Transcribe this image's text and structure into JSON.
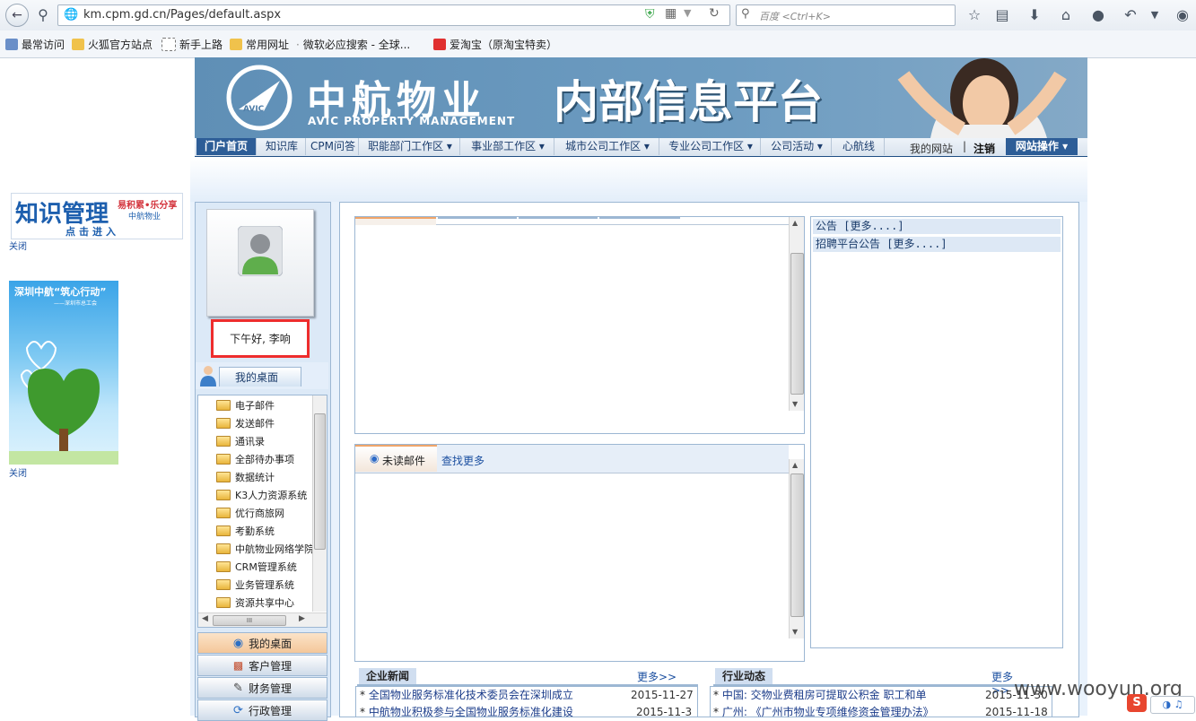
{
  "browser": {
    "url": "km.cpm.gd.cn/Pages/default.aspx",
    "search_placeholder": "百度 <Ctrl+K>",
    "bookmarks": [
      "最常访问",
      "火狐官方站点",
      "新手上路",
      "常用网址",
      "微软必应搜索 - 全球...",
      "爱淘宝（原淘宝特卖）"
    ]
  },
  "banner": {
    "logo_text": "中航物业",
    "logo_sub": "AVIC PROPERTY MANAGEMENT",
    "logo_badge": "AVIC",
    "platform_title": "内部信息平台"
  },
  "menu": {
    "items": [
      "门户首页",
      "知识库",
      "CPM问答",
      "职能部门工作区 ▾",
      "事业部工作区 ▾",
      "城市公司工作区 ▾",
      "专业公司工作区 ▾",
      "公司活动 ▾",
      "心航线"
    ],
    "my_site": "我的网站",
    "separator": "|",
    "logout": "注销",
    "site_ops": "网站操作 ▾"
  },
  "left_ads": {
    "ad1_title": "知识管理",
    "ad1_slogan": "易积累•乐分享",
    "ad1_brand": "中航物业",
    "ad1_enter": "点击进入",
    "ad2_title": "深圳中航“筑心行动”",
    "ad2_sub": "——深圳市总工会",
    "close": "关闭"
  },
  "user": {
    "greeting": "下午好, 李响"
  },
  "desktop": {
    "tab_label": "我的桌面",
    "tree": [
      "电子邮件",
      "发送邮件",
      "通讯录",
      "全部待办事项",
      "数据统计",
      "K3人力资源系统",
      "优行商旅网",
      "考勤系统",
      "中航物业网络学院",
      "CRM管理系统",
      "业务管理系统",
      "资源共享中心"
    ],
    "scroll_grip": "III",
    "nav_buttons": [
      "我的桌面",
      "客户管理",
      "财务管理",
      "行政管理"
    ]
  },
  "mail": {
    "tab_unread": "未读邮件",
    "find_more": "查找更多"
  },
  "notices": {
    "rows": [
      "公告 [更多....]",
      "招聘平台公告 [更多....]"
    ]
  },
  "news": {
    "company_title": "企业新闻",
    "company_more": "更多>>",
    "company_rows": [
      {
        "title": "全国物业服务标准化技术委员会在深圳成立",
        "date": "2015-11-27"
      },
      {
        "title": "中航物业积极参与全国物业服务标准化建设",
        "date": "2015-11-3"
      }
    ],
    "industry_title": "行业动态",
    "industry_more": "更多>>",
    "industry_rows": [
      {
        "title": "中国: 交物业费租房可提取公积金 职工和单",
        "date": "2015-11-30"
      },
      {
        "title": "广州: 《广州市物业专项维修资金管理办法》",
        "date": "2015-11-18"
      }
    ]
  },
  "watermark": "www.wooyun.org",
  "colors": {
    "nav_dark": "#2d5d97",
    "banner": "#6d9cc1",
    "highlight_red": "#ee2d2d",
    "link": "#1b4fa0"
  }
}
